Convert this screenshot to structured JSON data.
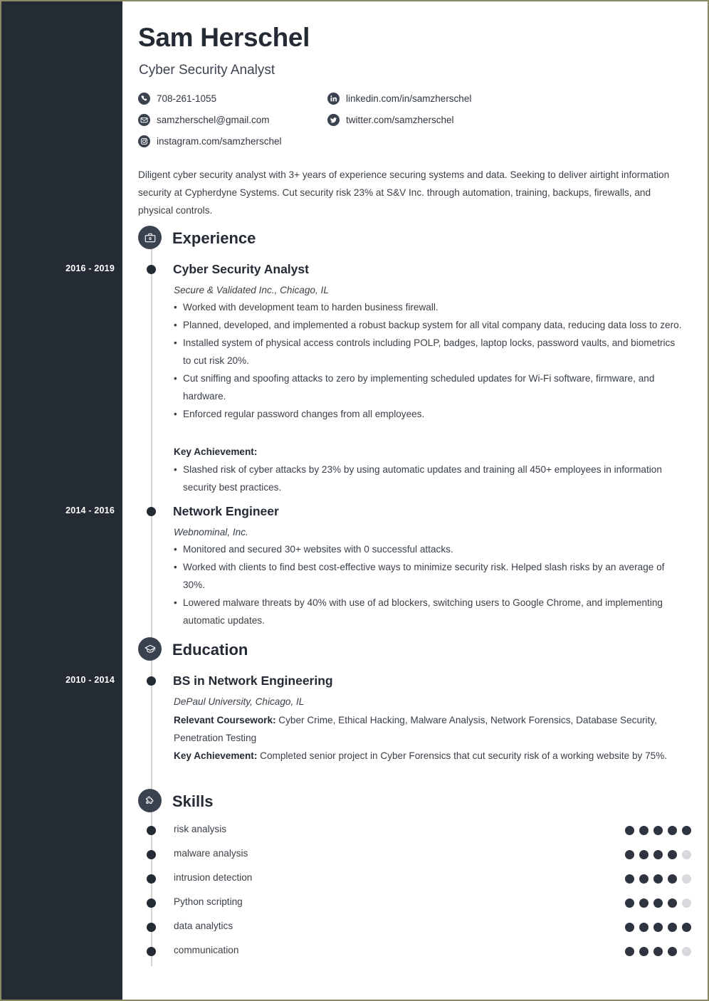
{
  "header": {
    "name": "Sam Herschel",
    "title": "Cyber Security Analyst"
  },
  "contacts": [
    {
      "icon": "phone-icon",
      "text": "708-261-1055"
    },
    {
      "icon": "email-icon",
      "text": "samzherschel@gmail.com"
    },
    {
      "icon": "instagram-icon",
      "text": "instagram.com/samzherschel"
    },
    {
      "icon": "linkedin-icon",
      "text": "linkedin.com/in/samzherschel"
    },
    {
      "icon": "twitter-icon",
      "text": "twitter.com/samzherschel"
    }
  ],
  "summary": "Diligent cyber security analyst with 3+ years of experience securing systems and data. Seeking to deliver airtight information security at Cypherdyne Systems. Cut security risk 23% at S&V Inc. through automation, training, backups, firewalls, and physical controls.",
  "sections": {
    "experience": {
      "title": "Experience",
      "icon": "briefcase-icon"
    },
    "education": {
      "title": "Education",
      "icon": "graduation-cap-icon"
    },
    "skills": {
      "title": "Skills",
      "icon": "puzzle-piece-icon"
    }
  },
  "experience": [
    {
      "dates": "2016 - 2019",
      "role": "Cyber Security Analyst",
      "company": "Secure & Validated Inc., Chicago, IL",
      "bullets": [
        "Worked with development team to harden business firewall.",
        "Planned, developed, and implemented a robust backup system for all vital company data, reducing data loss to zero.",
        "Installed system of physical access controls including POLP, badges, laptop locks, password vaults, and biometrics to cut risk 20%.",
        "Cut sniffing and spoofing attacks to zero by implementing scheduled updates for Wi-Fi software, firmware, and hardware.",
        "Enforced regular password changes from all employees."
      ],
      "key_achievement_label": "Key Achievement:",
      "key_achievement_bullets": [
        "Slashed risk of cyber attacks by 23% by using automatic updates and training all 450+ employees in information security best practices."
      ]
    },
    {
      "dates": "2014 - 2016",
      "role": "Network Engineer",
      "company": "Webnominal, Inc.",
      "bullets": [
        "Monitored and secured 30+ websites with 0 successful attacks.",
        "Worked with clients to find best cost-effective ways to minimize security risk. Helped slash risks by an average of 30%.",
        "Lowered malware threats by 40% with use of ad blockers, switching users to Google Chrome, and implementing automatic updates."
      ]
    }
  ],
  "education": [
    {
      "dates": "2010 - 2014",
      "degree": "BS in Network Engineering",
      "school": "DePaul University, Chicago, IL",
      "coursework_label": "Relevant Coursework:",
      "coursework": " Cyber Crime, Ethical Hacking, Malware Analysis, Network Forensics, Database Security, Penetration Testing",
      "key_achievement_label": "Key Achievement:",
      "key_achievement": " Completed senior project in Cyber Forensics that cut security risk of a working website by 75%."
    }
  ],
  "skills": [
    {
      "name": "risk analysis",
      "rating": 5,
      "max": 5
    },
    {
      "name": "malware analysis",
      "rating": 4,
      "max": 5
    },
    {
      "name": "intrusion detection",
      "rating": 4,
      "max": 5
    },
    {
      "name": "Python scripting",
      "rating": 4,
      "max": 5
    },
    {
      "name": "data analytics",
      "rating": 5,
      "max": 5
    },
    {
      "name": "communication",
      "rating": 4,
      "max": 5
    }
  ],
  "colors": {
    "sidebar": "#242b35",
    "accent_dot": "#2e3540",
    "empty_dot": "#d7d9dc",
    "page_border": "#8a8a63"
  }
}
